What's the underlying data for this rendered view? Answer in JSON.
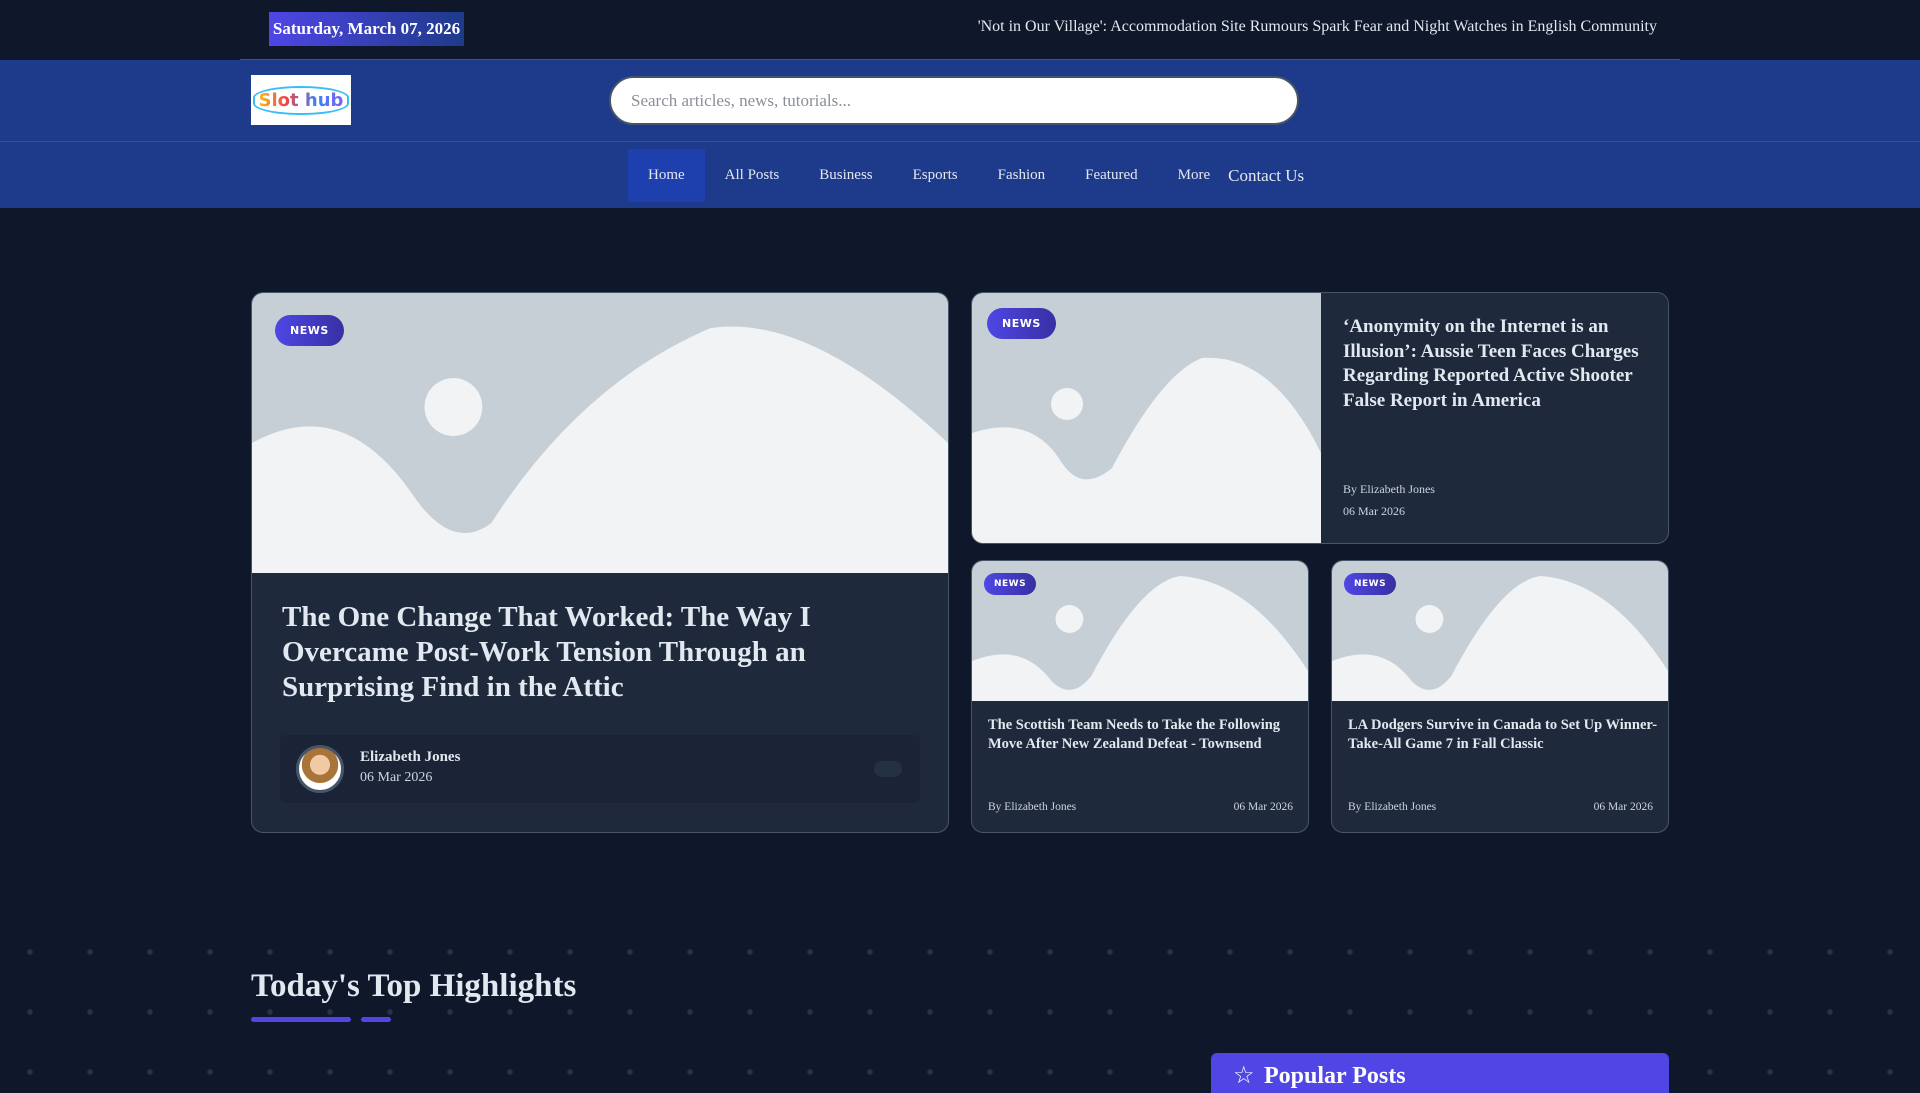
{
  "topbar": {
    "date": "Saturday, March 07, 2026",
    "ticker": "'Not in Our Village': Accommodation Site Rumours Spark Fear and Night Watches in English Community"
  },
  "header": {
    "logo_text": "Slot hub",
    "search_placeholder": "Search articles, news, tutorials..."
  },
  "nav": {
    "items": [
      "Home",
      "All Posts",
      "Business",
      "Esports",
      "Fashion",
      "Featured",
      "More"
    ],
    "contact": "Contact Us"
  },
  "featured": {
    "badge": "NEWS",
    "title": "The One Change That Worked: The Way I Overcame Post-Work Tension Through an Surprising Find in the Attic",
    "author": "Elizabeth Jones",
    "date": "06 Mar 2026"
  },
  "side": {
    "badge": "NEWS",
    "title": "‘Anonymity on the Internet is an Illusion’: Aussie Teen Faces Charges Regarding Reported Active Shooter False Report in America",
    "author": "By Elizabeth Jones",
    "date": "06 Mar 2026"
  },
  "small": [
    {
      "badge": "NEWS",
      "title": "The Scottish Team Needs to Take the Following Move After New Zealand Defeat - Townsend",
      "author": "By Elizabeth Jones",
      "date": "06 Mar 2026"
    },
    {
      "badge": "NEWS",
      "title": "LA Dodgers Survive in Canada to Set Up Winner-Take-All Game 7 in Fall Classic",
      "author": "By Elizabeth Jones",
      "date": "06 Mar 2026"
    }
  ],
  "highlights": {
    "title": "Today's Top Highlights"
  },
  "popular": {
    "title": "Popular Posts",
    "icon": "star-icon"
  }
}
